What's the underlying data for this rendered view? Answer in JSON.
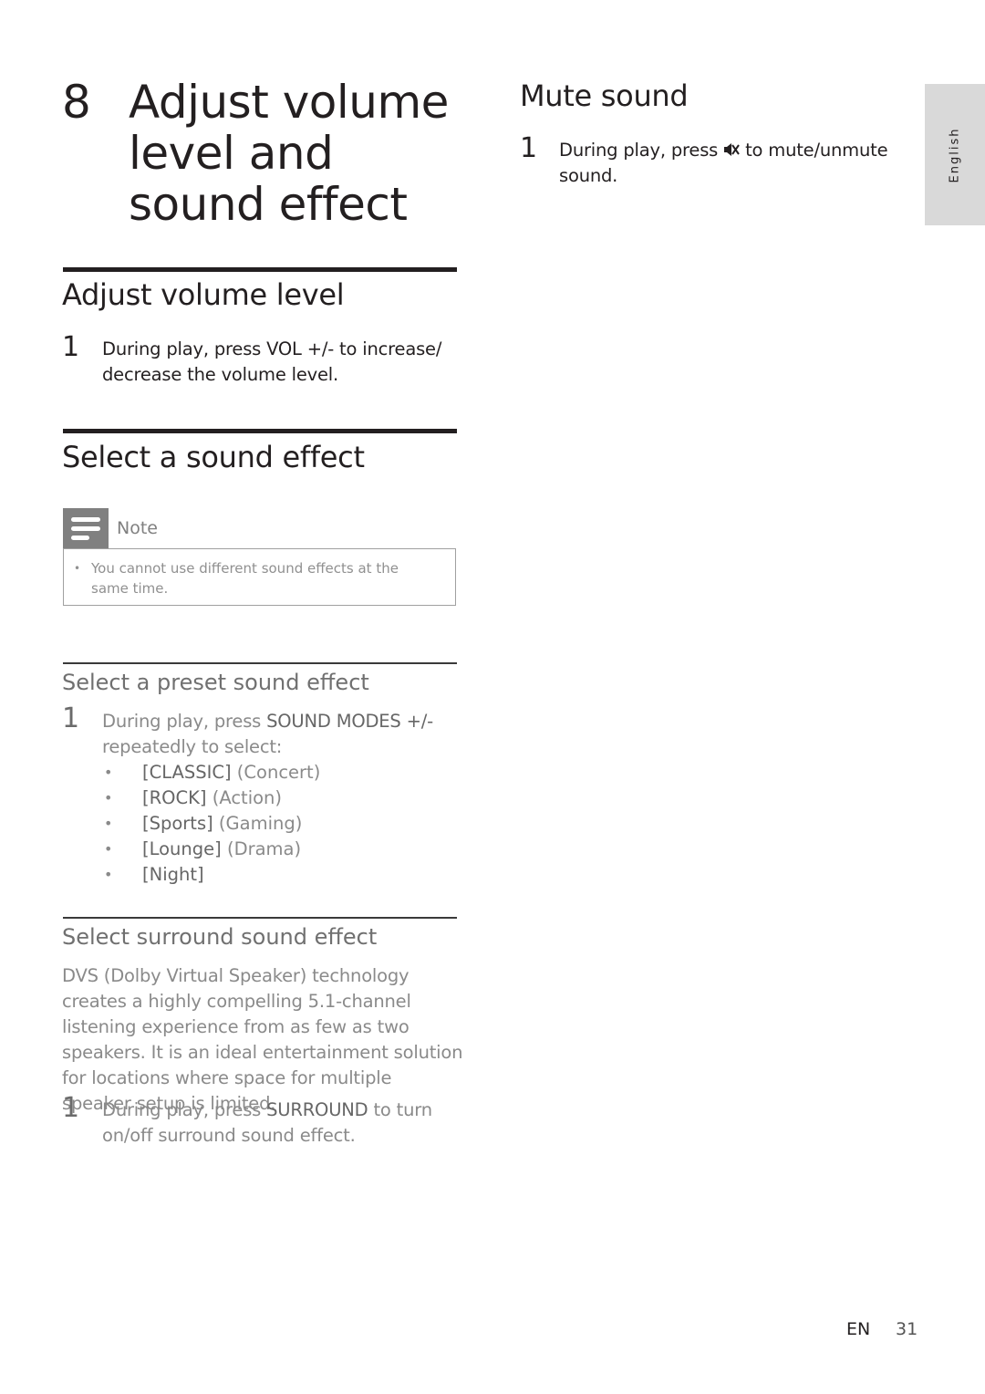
{
  "sidebar_tab": {
    "label": "English"
  },
  "chapter": {
    "number": "8",
    "title": "Adjust volume level and sound effect"
  },
  "sections": {
    "adjust_volume": {
      "heading": "Adjust volume level",
      "step": {
        "number": "1",
        "pre": "During play, press ",
        "keyword": "VOL +/-",
        "post": " to increase/ decrease the volume level."
      }
    },
    "select_sound_effect": {
      "heading": "Select a sound effect",
      "note": {
        "label": "Note",
        "icon": "note-icon",
        "items": [
          "You cannot use different sound effects at the same time."
        ]
      }
    },
    "preset_sound_effect": {
      "heading": "Select a preset sound effect",
      "step": {
        "number": "1",
        "pre": "During play, press ",
        "keyword": "SOUND MODES +/-",
        "post": " repeatedly to select:"
      },
      "options": [
        {
          "keyword": "[CLASSIC]",
          "desc": " (Concert)"
        },
        {
          "keyword": "[ROCK]",
          "desc": " (Action)"
        },
        {
          "keyword": "[Sports]",
          "desc": " (Gaming)"
        },
        {
          "keyword": "[Lounge]",
          "desc": " (Drama)"
        },
        {
          "keyword": "[Night]",
          "desc": ""
        }
      ]
    },
    "surround_sound_effect": {
      "heading": "Select surround sound effect",
      "description": "DVS (Dolby Virtual Speaker) technology creates a highly compelling 5.1-channel listening experience from as few as two speakers. It is an ideal entertainment solution for locations where space for multiple speaker setup is limited.",
      "step": {
        "number": "1",
        "pre": "During play, press ",
        "keyword": "SURROUND",
        "post": " to turn on/off surround sound effect."
      }
    },
    "mute_sound": {
      "heading": "Mute sound",
      "step": {
        "number": "1",
        "pre": "During play, press ",
        "icon": "mute-icon",
        "post": " to mute/unmute sound."
      }
    }
  },
  "footer": {
    "language": "EN",
    "page_number": "31"
  }
}
